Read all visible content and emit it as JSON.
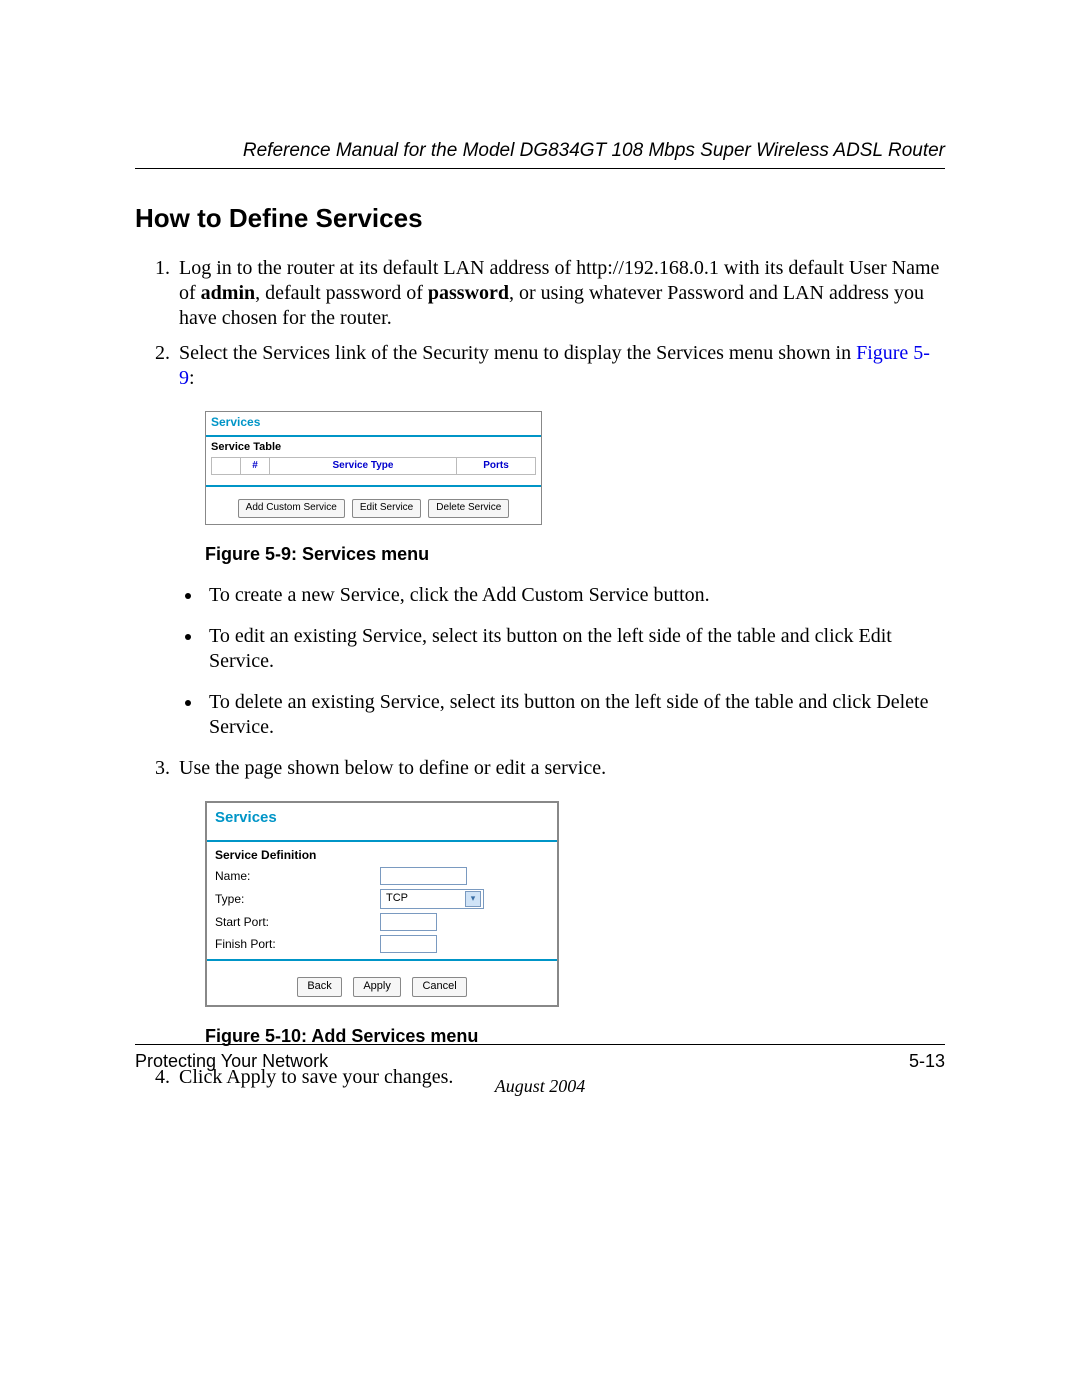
{
  "header": "Reference Manual for the Model DG834GT 108 Mbps Super Wireless ADSL Router",
  "section_title": "How to Define Services",
  "step1_a": "Log in to the router at its default LAN address of http://192.168.0.1 with its default User Name of ",
  "step1_bold1": "admin",
  "step1_b": ", default password of ",
  "step1_bold2": "password",
  "step1_c": ", or using whatever Password and LAN address you have chosen for the router.",
  "step2_a": "Select the Services link of the Security menu to display the Services menu shown in ",
  "step2_link": "Figure 5-9",
  "step2_b": ":",
  "fig1": {
    "title": "Services",
    "subtitle": "Service Table",
    "headers": {
      "col1": "#",
      "col2": "Service Type",
      "col3": "Ports"
    },
    "buttons": {
      "add": "Add Custom Service",
      "edit": "Edit Service",
      "del": "Delete Service"
    },
    "caption": "Figure 5-9:  Services menu"
  },
  "bullets": {
    "b1": "To create a new Service, click the Add Custom Service button.",
    "b2": "To edit an existing Service, select its button on the left side of the table and click Edit Service.",
    "b3": "To delete an existing Service, select its button on the left side of the table and click Delete Service."
  },
  "step3": "Use the page shown below to define or edit a service.",
  "fig2": {
    "title": "Services",
    "subtitle": "Service Definition",
    "rows": {
      "name": "Name:",
      "type": "Type:",
      "start": "Start Port:",
      "finish": "Finish Port:"
    },
    "type_value": "TCP",
    "buttons": {
      "back": "Back",
      "apply": "Apply",
      "cancel": "Cancel"
    },
    "caption": "Figure 5-10:  Add Services menu"
  },
  "step4": "Click Apply to save your changes.",
  "footer": {
    "left": "Protecting Your Network",
    "right": "5-13",
    "date": "August 2004"
  }
}
